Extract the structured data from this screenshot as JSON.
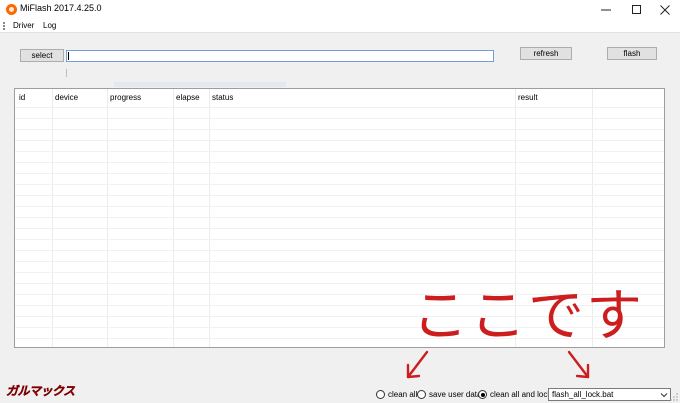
{
  "window": {
    "title": "MiFlash 2017.4.25.0",
    "icon": "miflash-app-icon",
    "brand_color": "#ff6700"
  },
  "menu": {
    "items": [
      "Driver",
      "Log"
    ]
  },
  "toolbar": {
    "select_label": "select",
    "path_value": "",
    "refresh_label": "refresh",
    "flash_label": "flash"
  },
  "table": {
    "columns": [
      "id",
      "device",
      "progress",
      "elapse",
      "status",
      "result"
    ],
    "rows": []
  },
  "annotation": {
    "text": "ここです",
    "color": "#cc1e1e"
  },
  "watermark": {
    "text": "ガルマックス"
  },
  "options": {
    "clean_all_label": "clean all",
    "save_user_data_label": "save user data",
    "clean_all_and_lock_label": "clean all and lock",
    "selected": "clean all and lock",
    "script_value": "flash_all_lock.bat"
  }
}
